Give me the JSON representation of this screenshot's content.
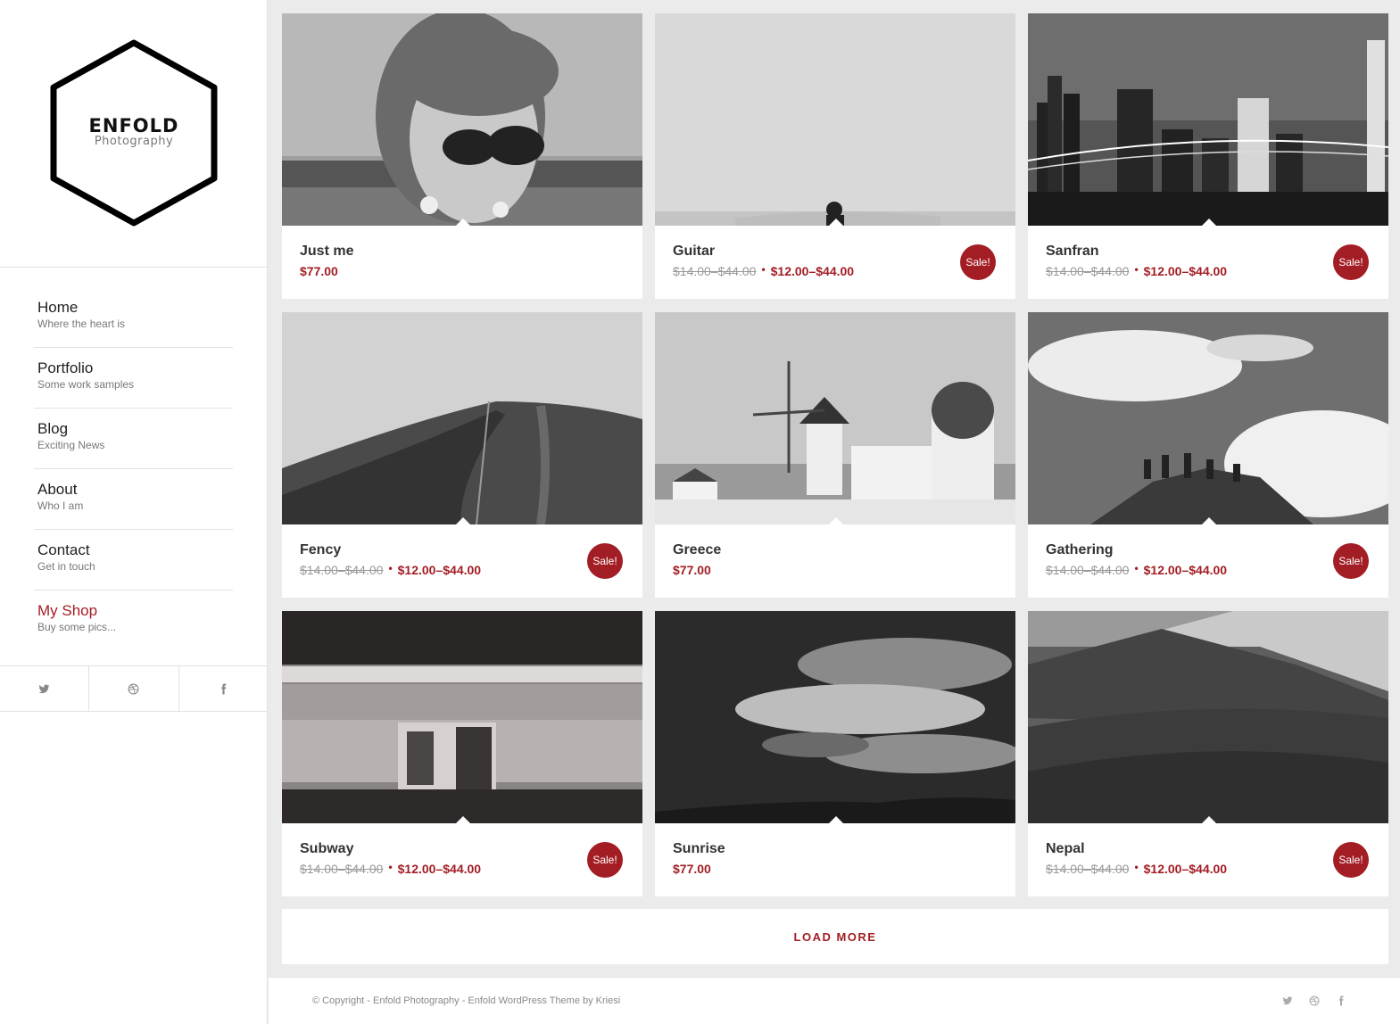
{
  "logo": {
    "title": "ENFOLD",
    "subtitle": "Photography"
  },
  "nav": [
    {
      "label": "Home",
      "sub": "Where the heart is"
    },
    {
      "label": "Portfolio",
      "sub": "Some work samples"
    },
    {
      "label": "Blog",
      "sub": "Exciting News"
    },
    {
      "label": "About",
      "sub": "Who I am"
    },
    {
      "label": "Contact",
      "sub": "Get in touch"
    },
    {
      "label": "My Shop",
      "sub": "Buy some pics...",
      "active": true
    }
  ],
  "social": [
    "twitter-icon",
    "dribbble-icon",
    "facebook-icon"
  ],
  "products": [
    {
      "title": "Just me",
      "price": "$77.00",
      "sale": false
    },
    {
      "title": "Guitar",
      "old_price": "$14.00–$44.00",
      "price": "$12.00–$44.00",
      "sale": true,
      "sale_label": "Sale!"
    },
    {
      "title": "Sanfran",
      "old_price": "$14.00–$44.00",
      "price": "$12.00–$44.00",
      "sale": true,
      "sale_label": "Sale!"
    },
    {
      "title": "Fency",
      "old_price": "$14.00–$44.00",
      "price": "$12.00–$44.00",
      "sale": true,
      "sale_label": "Sale!"
    },
    {
      "title": "Greece",
      "price": "$77.00",
      "sale": false
    },
    {
      "title": "Gathering",
      "old_price": "$14.00–$44.00",
      "price": "$12.00–$44.00",
      "sale": true,
      "sale_label": "Sale!"
    },
    {
      "title": "Subway",
      "old_price": "$14.00–$44.00",
      "price": "$12.00–$44.00",
      "sale": true,
      "sale_label": "Sale!"
    },
    {
      "title": "Sunrise",
      "price": "$77.00",
      "sale": false
    },
    {
      "title": "Nepal",
      "old_price": "$14.00–$44.00",
      "price": "$12.00–$44.00",
      "sale": true,
      "sale_label": "Sale!"
    }
  ],
  "load_more": "LOAD MORE",
  "footer": {
    "copyright": "© Copyright - Enfold Photography - Enfold WordPress Theme by Kriesi"
  },
  "colors": {
    "accent": "#a31d24",
    "background": "#ebebeb"
  }
}
